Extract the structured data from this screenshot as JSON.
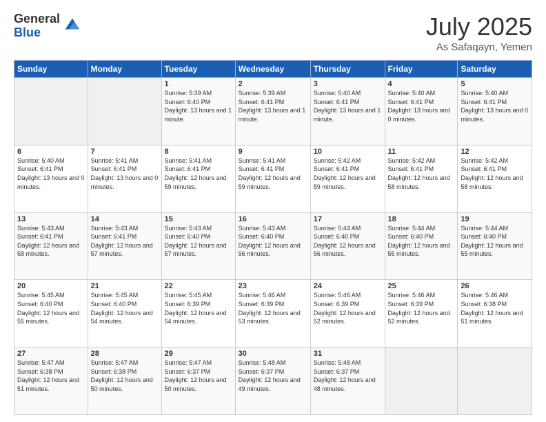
{
  "logo": {
    "general": "General",
    "blue": "Blue"
  },
  "title": {
    "month": "July 2025",
    "location": "As Safaqayn, Yemen"
  },
  "headers": [
    "Sunday",
    "Monday",
    "Tuesday",
    "Wednesday",
    "Thursday",
    "Friday",
    "Saturday"
  ],
  "weeks": [
    [
      {
        "day": "",
        "info": ""
      },
      {
        "day": "",
        "info": ""
      },
      {
        "day": "1",
        "info": "Sunrise: 5:39 AM\nSunset: 6:40 PM\nDaylight: 13 hours and 1 minute."
      },
      {
        "day": "2",
        "info": "Sunrise: 5:39 AM\nSunset: 6:41 PM\nDaylight: 13 hours and 1 minute."
      },
      {
        "day": "3",
        "info": "Sunrise: 5:40 AM\nSunset: 6:41 PM\nDaylight: 13 hours and 1 minute."
      },
      {
        "day": "4",
        "info": "Sunrise: 5:40 AM\nSunset: 6:41 PM\nDaylight: 13 hours and 0 minutes."
      },
      {
        "day": "5",
        "info": "Sunrise: 5:40 AM\nSunset: 6:41 PM\nDaylight: 13 hours and 0 minutes."
      }
    ],
    [
      {
        "day": "6",
        "info": "Sunrise: 5:40 AM\nSunset: 6:41 PM\nDaylight: 13 hours and 0 minutes."
      },
      {
        "day": "7",
        "info": "Sunrise: 5:41 AM\nSunset: 6:41 PM\nDaylight: 13 hours and 0 minutes."
      },
      {
        "day": "8",
        "info": "Sunrise: 5:41 AM\nSunset: 6:41 PM\nDaylight: 12 hours and 59 minutes."
      },
      {
        "day": "9",
        "info": "Sunrise: 5:41 AM\nSunset: 6:41 PM\nDaylight: 12 hours and 59 minutes."
      },
      {
        "day": "10",
        "info": "Sunrise: 5:42 AM\nSunset: 6:41 PM\nDaylight: 12 hours and 59 minutes."
      },
      {
        "day": "11",
        "info": "Sunrise: 5:42 AM\nSunset: 6:41 PM\nDaylight: 12 hours and 58 minutes."
      },
      {
        "day": "12",
        "info": "Sunrise: 5:42 AM\nSunset: 6:41 PM\nDaylight: 12 hours and 58 minutes."
      }
    ],
    [
      {
        "day": "13",
        "info": "Sunrise: 5:43 AM\nSunset: 6:41 PM\nDaylight: 12 hours and 58 minutes."
      },
      {
        "day": "14",
        "info": "Sunrise: 5:43 AM\nSunset: 6:41 PM\nDaylight: 12 hours and 57 minutes."
      },
      {
        "day": "15",
        "info": "Sunrise: 5:43 AM\nSunset: 6:40 PM\nDaylight: 12 hours and 57 minutes."
      },
      {
        "day": "16",
        "info": "Sunrise: 5:43 AM\nSunset: 6:40 PM\nDaylight: 12 hours and 56 minutes."
      },
      {
        "day": "17",
        "info": "Sunrise: 5:44 AM\nSunset: 6:40 PM\nDaylight: 12 hours and 56 minutes."
      },
      {
        "day": "18",
        "info": "Sunrise: 5:44 AM\nSunset: 6:40 PM\nDaylight: 12 hours and 55 minutes."
      },
      {
        "day": "19",
        "info": "Sunrise: 5:44 AM\nSunset: 6:40 PM\nDaylight: 12 hours and 55 minutes."
      }
    ],
    [
      {
        "day": "20",
        "info": "Sunrise: 5:45 AM\nSunset: 6:40 PM\nDaylight: 12 hours and 55 minutes."
      },
      {
        "day": "21",
        "info": "Sunrise: 5:45 AM\nSunset: 6:40 PM\nDaylight: 12 hours and 54 minutes."
      },
      {
        "day": "22",
        "info": "Sunrise: 5:45 AM\nSunset: 6:39 PM\nDaylight: 12 hours and 54 minutes."
      },
      {
        "day": "23",
        "info": "Sunrise: 5:46 AM\nSunset: 6:39 PM\nDaylight: 12 hours and 53 minutes."
      },
      {
        "day": "24",
        "info": "Sunrise: 5:46 AM\nSunset: 6:39 PM\nDaylight: 12 hours and 52 minutes."
      },
      {
        "day": "25",
        "info": "Sunrise: 5:46 AM\nSunset: 6:39 PM\nDaylight: 12 hours and 52 minutes."
      },
      {
        "day": "26",
        "info": "Sunrise: 5:46 AM\nSunset: 6:38 PM\nDaylight: 12 hours and 51 minutes."
      }
    ],
    [
      {
        "day": "27",
        "info": "Sunrise: 5:47 AM\nSunset: 6:38 PM\nDaylight: 12 hours and 51 minutes."
      },
      {
        "day": "28",
        "info": "Sunrise: 5:47 AM\nSunset: 6:38 PM\nDaylight: 12 hours and 50 minutes."
      },
      {
        "day": "29",
        "info": "Sunrise: 5:47 AM\nSunset: 6:37 PM\nDaylight: 12 hours and 50 minutes."
      },
      {
        "day": "30",
        "info": "Sunrise: 5:48 AM\nSunset: 6:37 PM\nDaylight: 12 hours and 49 minutes."
      },
      {
        "day": "31",
        "info": "Sunrise: 5:48 AM\nSunset: 6:37 PM\nDaylight: 12 hours and 48 minutes."
      },
      {
        "day": "",
        "info": ""
      },
      {
        "day": "",
        "info": ""
      }
    ]
  ]
}
